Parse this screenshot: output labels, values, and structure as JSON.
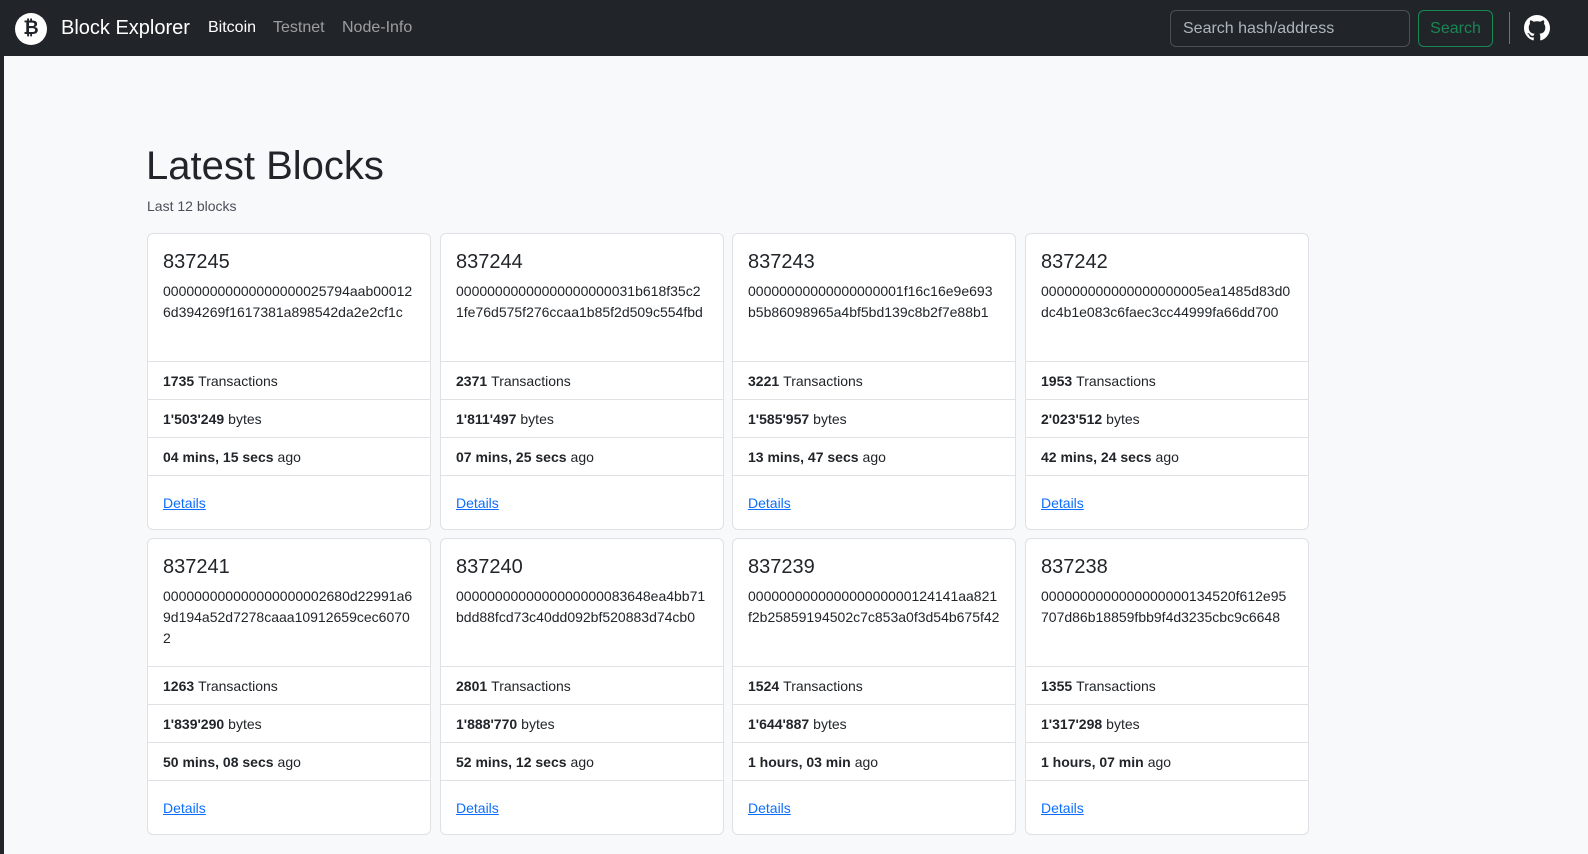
{
  "navbar": {
    "logo_glyph": "₿",
    "brand": "Block Explorer",
    "links": [
      {
        "label": "Bitcoin",
        "active": true
      },
      {
        "label": "Testnet",
        "active": false
      },
      {
        "label": "Node-Info",
        "active": false
      }
    ],
    "search_placeholder": "Search hash/address",
    "search_button": "Search",
    "github_icon": "github-icon"
  },
  "main": {
    "title": "Latest Blocks",
    "subtitle": "Last 12 blocks",
    "blocks": [
      {
        "height": "837245",
        "hash": "000000000000000000025794aab000126d394269f1617381a898542da2e2cf1c",
        "tx_count": "1735",
        "tx_label": "Transactions",
        "size": "1'503'249",
        "size_unit": "bytes",
        "age": "04 mins, 15 secs",
        "age_suffix": "ago",
        "link": "Details"
      },
      {
        "height": "837244",
        "hash": "00000000000000000000031b618f35c21fe76d575f276ccaa1b85f2d509c554fbd",
        "tx_count": "2371",
        "tx_label": "Transactions",
        "size": "1'811'497",
        "size_unit": "bytes",
        "age": "07 mins, 25 secs",
        "age_suffix": "ago",
        "link": "Details"
      },
      {
        "height": "837243",
        "hash": "00000000000000000001f16c16e9e693b5b86098965a4bf5bd139c8b2f7e88b1",
        "tx_count": "3221",
        "tx_label": "Transactions",
        "size": "1'585'957",
        "size_unit": "bytes",
        "age": "13 mins, 47 secs",
        "age_suffix": "ago",
        "link": "Details"
      },
      {
        "height": "837242",
        "hash": "000000000000000000005ea1485d83d0dc4b1e083c6faec3cc44999fa66dd700",
        "tx_count": "1953",
        "tx_label": "Transactions",
        "size": "2'023'512",
        "size_unit": "bytes",
        "age": "42 mins, 24 secs",
        "age_suffix": "ago",
        "link": "Details"
      },
      {
        "height": "837241",
        "hash": "000000000000000000002680d22991a69d194a52d7278caaa10912659cec60702",
        "tx_count": "1263",
        "tx_label": "Transactions",
        "size": "1'839'290",
        "size_unit": "bytes",
        "age": "50 mins, 08 secs",
        "age_suffix": "ago",
        "link": "Details"
      },
      {
        "height": "837240",
        "hash": "0000000000000000000083648ea4bb71bdd88fcd73c40dd092bf520883d74cb0",
        "tx_count": "2801",
        "tx_label": "Transactions",
        "size": "1'888'770",
        "size_unit": "bytes",
        "age": "52 mins, 12 secs",
        "age_suffix": "ago",
        "link": "Details"
      },
      {
        "height": "837239",
        "hash": "000000000000000000000124141aa821f2b25859194502c7c853a0f3d54b675f42",
        "tx_count": "1524",
        "tx_label": "Transactions",
        "size": "1'644'887",
        "size_unit": "bytes",
        "age": "1 hours, 03 min",
        "age_suffix": "ago",
        "link": "Details"
      },
      {
        "height": "837238",
        "hash": "0000000000000000000134520f612e95707d86b18859fbb9f4d3235cbc9c6648",
        "tx_count": "1355",
        "tx_label": "Transactions",
        "size": "1'317'298",
        "size_unit": "bytes",
        "age": "1 hours, 07 min",
        "age_suffix": "ago",
        "link": "Details"
      }
    ]
  }
}
